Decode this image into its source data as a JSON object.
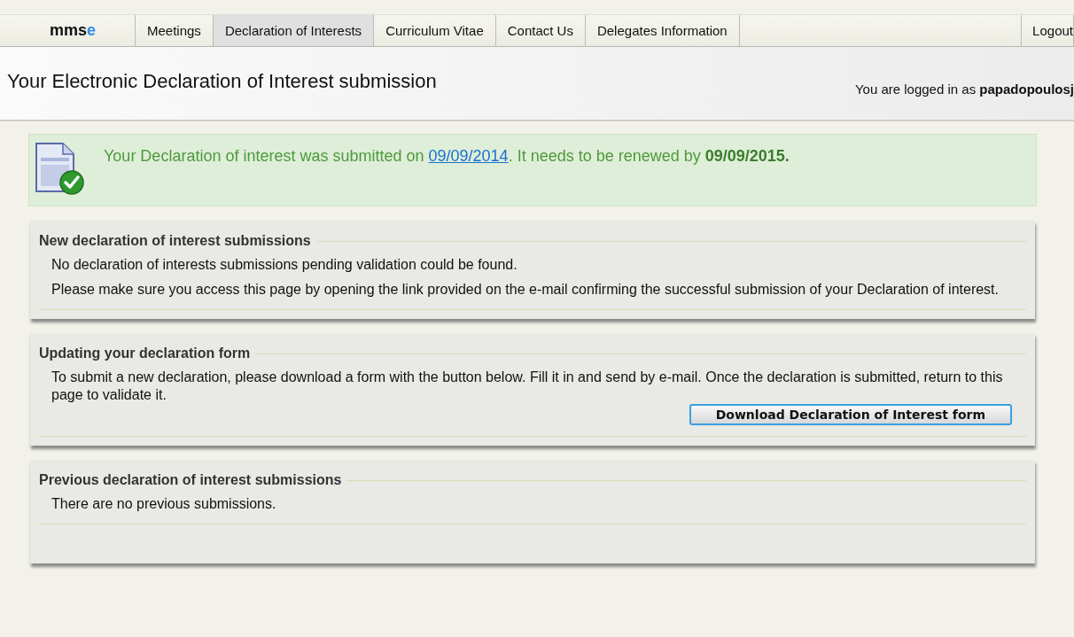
{
  "nav": {
    "logo": {
      "text": "mms",
      "accent": "e"
    },
    "tabs": [
      {
        "label": "Meetings",
        "selected": false
      },
      {
        "label": "Declaration of Interests",
        "selected": true
      },
      {
        "label": "Curriculum Vitae",
        "selected": false
      },
      {
        "label": "Contact Us",
        "selected": false
      },
      {
        "label": "Delegates Information",
        "selected": false
      }
    ],
    "logout": "Logout"
  },
  "header": {
    "title": "Your Electronic Declaration of Interest submission",
    "login_prefix": "You are logged in as",
    "username": "papadopoulosj"
  },
  "notice": {
    "before": "Your Declaration of interest was submitted on",
    "link": "09/09/2014",
    "after": ". It needs to be renewed by **09/09/2015.**"
  },
  "panels": [
    {
      "title": "New declaration of interest submissions",
      "paragraphs": [
        "No declaration of interests submissions pending validation could be found.",
        "Please make sure you access this page by opening the link provided on the e-mail confirming the successful submission of your Declaration of interest."
      ]
    },
    {
      "title": "Updating your declaration form",
      "paragraphs": [
        "To submit a new declaration, please download a form with the button below. Fill it in and send by e-mail. Once the declaration is submitted, return to this page to validate it."
      ],
      "button": "Download Declaration of Interest form"
    },
    {
      "title": "Previous declaration of interest submissions",
      "paragraphs": [
        "There are no previous submissions."
      ]
    }
  ]
}
